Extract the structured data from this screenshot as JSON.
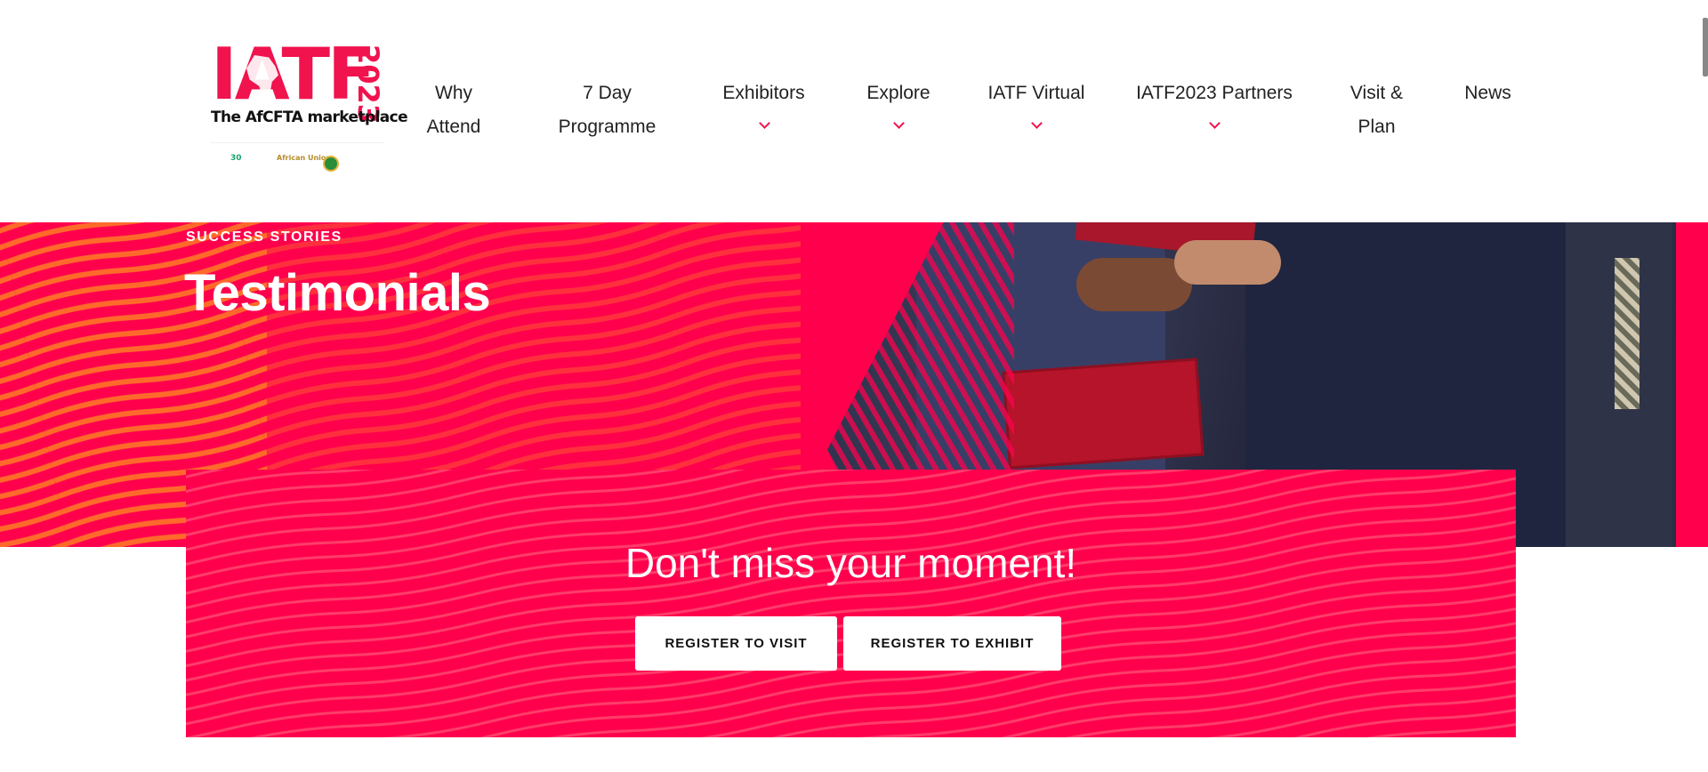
{
  "header": {
    "logo": {
      "wordmark": "IATF",
      "year": "2023",
      "tagline": "The AfCFTA marketplace",
      "partners": [
        "30",
        "African Union"
      ]
    },
    "nav": [
      {
        "label": "Why Attend",
        "dropdown": false
      },
      {
        "label": "7 Day Programme",
        "dropdown": false
      },
      {
        "label": "Exhibitors",
        "dropdown": true
      },
      {
        "label": "Explore",
        "dropdown": true
      },
      {
        "label": "IATF Virtual",
        "dropdown": true
      },
      {
        "label": "IATF2023 Partners",
        "dropdown": true
      },
      {
        "label": "Visit & Plan",
        "dropdown": false
      },
      {
        "label": "News",
        "dropdown": false
      }
    ]
  },
  "hero": {
    "eyebrow": "SUCCESS STORIES",
    "title": "Testimonials"
  },
  "cta": {
    "title": "Don't miss your moment!",
    "register_visit": "REGISTER TO VISIT",
    "register_exhibit": "REGISTER TO EXHIBIT"
  },
  "colors": {
    "brand": "#ff004d",
    "accent": "#f0134d",
    "wave": "#ff6a2b",
    "text": "#222222"
  },
  "icons": {
    "dropdown": "chevron-down-icon"
  }
}
